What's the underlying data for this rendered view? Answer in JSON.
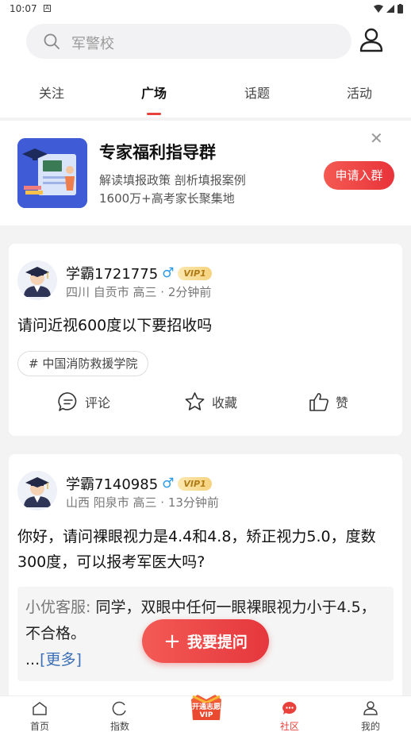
{
  "status": {
    "time": "10:07"
  },
  "search": {
    "placeholder": "军警校"
  },
  "tabs": [
    {
      "label": "关注"
    },
    {
      "label": "广场"
    },
    {
      "label": "话题"
    },
    {
      "label": "活动"
    }
  ],
  "banner": {
    "title": "专家福利指导群",
    "line1": "解读填报政策  剖析填报案例",
    "line2": "1600万+高考家长聚集地",
    "button": "申请入群",
    "close": "✕"
  },
  "posts": [
    {
      "user": "学霸1721775",
      "gender": "♂",
      "vip": "VIP1",
      "meta": "四川 自贡市 高三 · 2分钟前",
      "question": "请问近视600度以下要招收吗",
      "tag": "# 中国消防救援学院",
      "actions": {
        "comment": "评论",
        "fav": "收藏",
        "like": "赞"
      }
    },
    {
      "user": "学霸7140985",
      "gender": "♂",
      "vip": "VIP1",
      "meta": "山西 阳泉市 高三 · 13分钟前",
      "question": "你好，请问裸眼视力是4.4和4.8，矫正视力5.0，度数300度，可以报考军医大吗?",
      "answer_who": "小优客服:",
      "answer": " 同学，双眼中任何一眼裸眼视力小于4.5，不合格。",
      "answer_more_prefix": "...",
      "answer_more": "[更多]"
    }
  ],
  "fab": {
    "label": "我要提问",
    "plus": "+"
  },
  "bottom_nav": [
    {
      "label": "首页"
    },
    {
      "label": "指数"
    },
    {
      "label": "开通志愿VIP"
    },
    {
      "label": "社区"
    },
    {
      "label": "我的"
    }
  ],
  "colors": {
    "accent": "#e8413c",
    "vip_gold": "#b07a14",
    "male_blue": "#2a9be8"
  }
}
